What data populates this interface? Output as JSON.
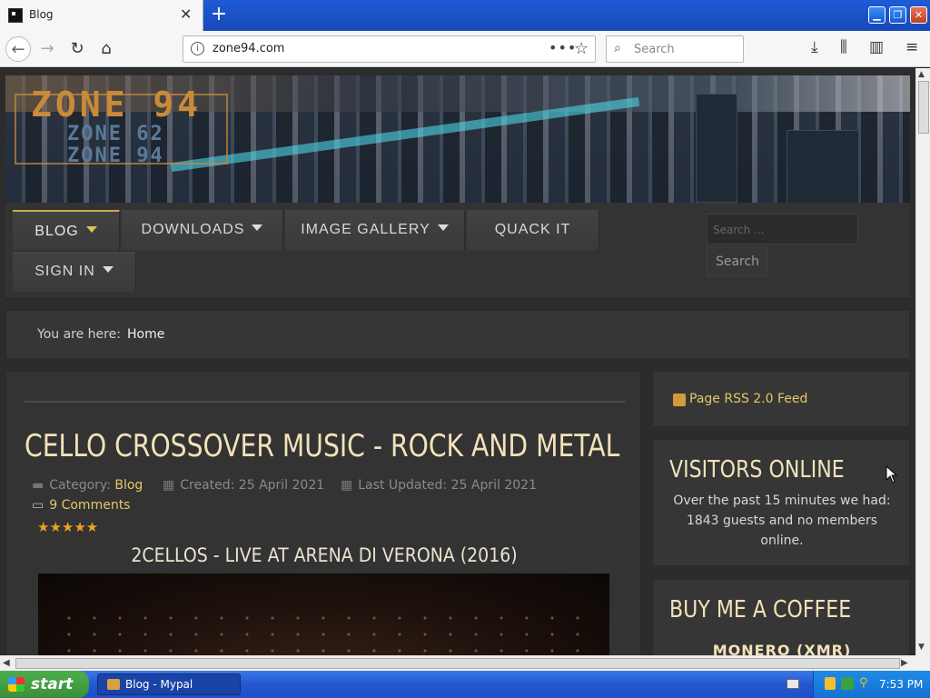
{
  "browser": {
    "tab_title": "Blog",
    "url": "zone94.com",
    "search_placeholder": "Search"
  },
  "site": {
    "logo": {
      "main": "ZONE 94",
      "sub1": "ZONE 62",
      "sub2": "ZONE 94"
    },
    "menu": [
      {
        "label": "BLOG",
        "has_caret": true,
        "active": true
      },
      {
        "label": "DOWNLOADS",
        "has_caret": true
      },
      {
        "label": "IMAGE GALLERY",
        "has_caret": true
      },
      {
        "label": "QUACK IT",
        "has_caret": false
      },
      {
        "label": "SIGN IN",
        "has_caret": true
      }
    ],
    "search": {
      "placeholder": "Search ...",
      "button": "Search"
    },
    "breadcrumb": {
      "prefix": "You are here:",
      "current": "Home"
    }
  },
  "article": {
    "title": "CELLO CROSSOVER MUSIC - ROCK AND METAL",
    "category_label": "Category:",
    "category": "Blog",
    "created": "Created: 25 April 2021",
    "updated": "Last Updated: 25 April 2021",
    "comments": "9 Comments",
    "rating_stars": "★★★★★",
    "subtitle": "2CELLOS - LIVE AT ARENA DI VERONA (2016)"
  },
  "sidebar": {
    "rss": "Page RSS 2.0 Feed",
    "visitors_title": "VISITORS ONLINE",
    "visitors_text": "Over the past 15 minutes we had: 1843 guests and no members online.",
    "coffee_title": "BUY ME A COFFEE",
    "coffee_sub": "MONERO (XMR)"
  },
  "taskbar": {
    "start": "start",
    "task": "Blog - Mypal",
    "clock": "7:53 PM"
  },
  "colors": {
    "accent": "#e4c866",
    "heading": "#f2e2b8",
    "page_bg": "#2c2c2c"
  }
}
